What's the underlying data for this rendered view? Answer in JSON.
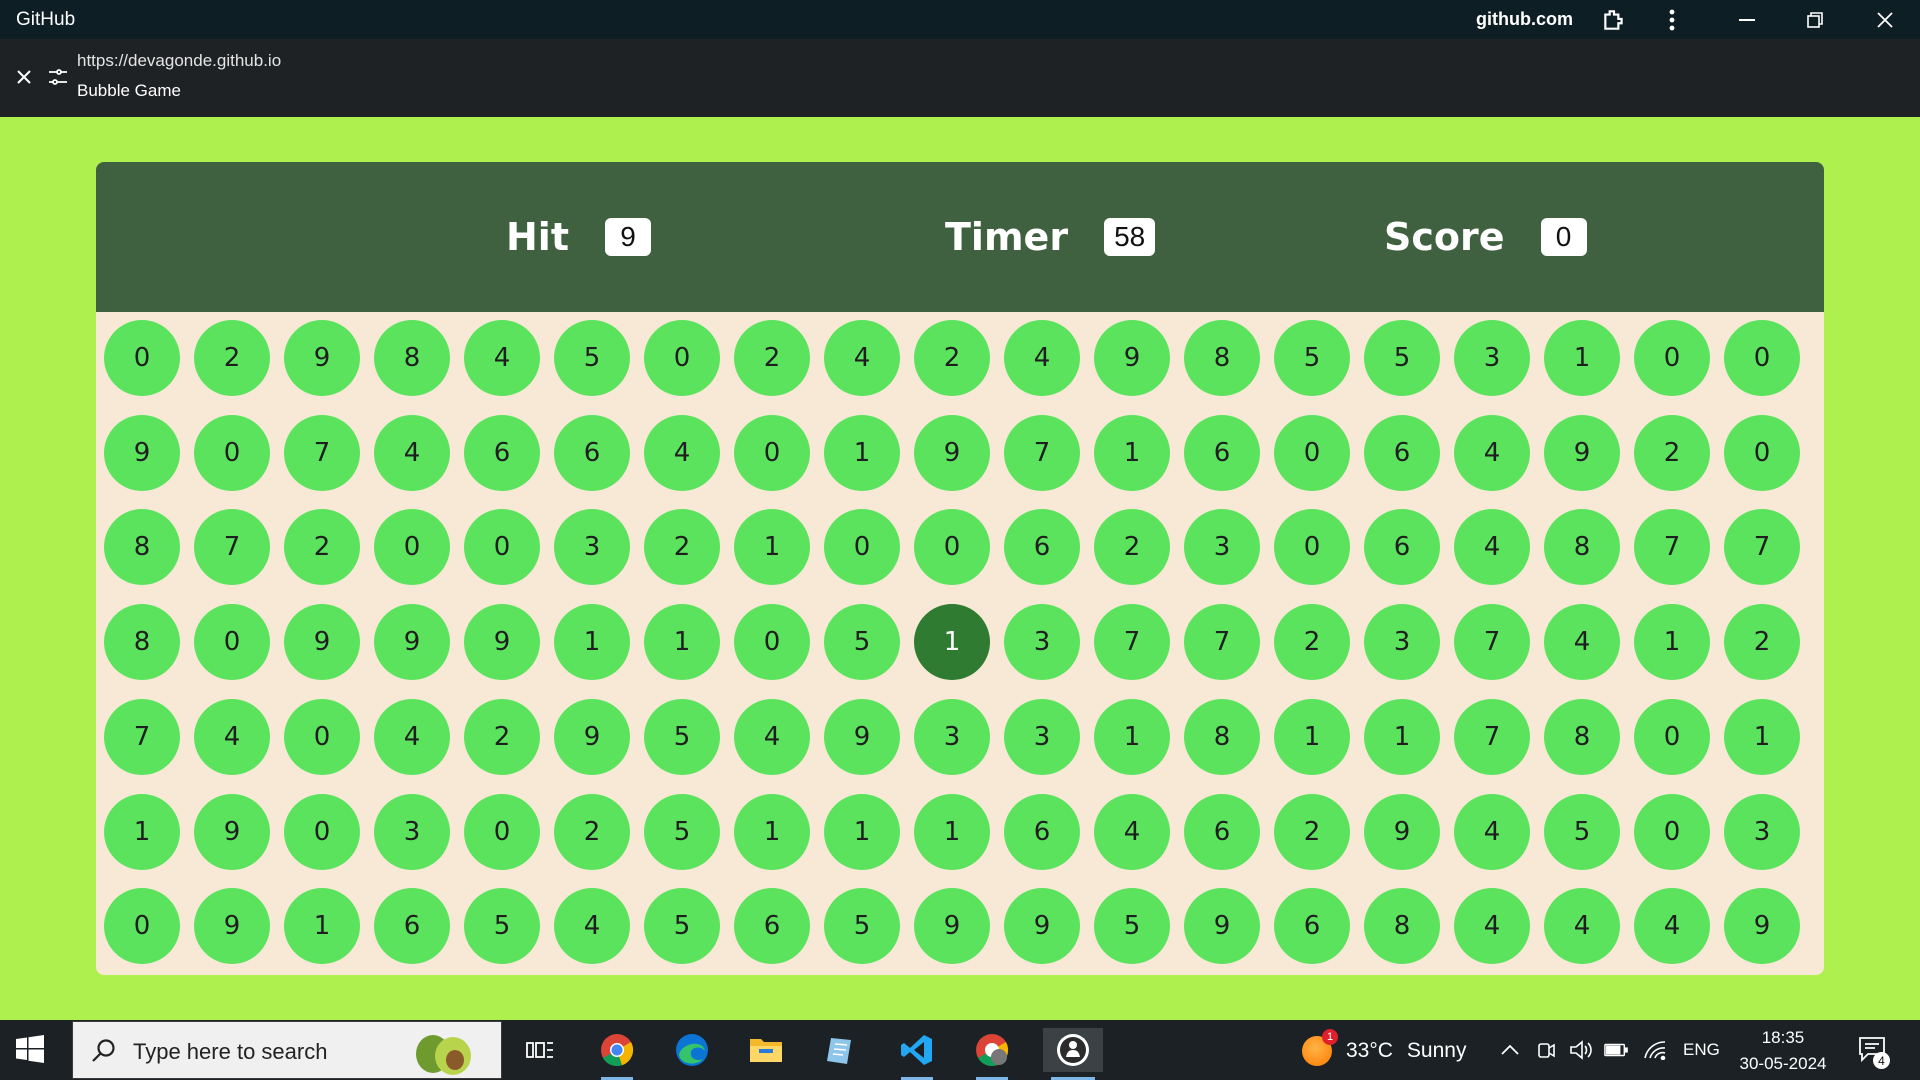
{
  "window": {
    "app_title": "GitHub",
    "host": "github.com",
    "url": "https://devagonde.github.io",
    "page_title": "Bubble Game"
  },
  "game": {
    "hit_label": "Hit",
    "hit_value": "9",
    "timer_label": "Timer",
    "timer_value": "58",
    "score_label": "Score",
    "score_value": "0",
    "highlighted": {
      "row": 3,
      "col": 9
    },
    "grid": [
      [
        0,
        2,
        9,
        8,
        4,
        5,
        0,
        2,
        4,
        2,
        4,
        9,
        8,
        5,
        5,
        3,
        1,
        0,
        0
      ],
      [
        9,
        0,
        7,
        4,
        6,
        6,
        4,
        0,
        1,
        9,
        7,
        1,
        6,
        0,
        6,
        4,
        9,
        2,
        0
      ],
      [
        8,
        7,
        2,
        0,
        0,
        3,
        2,
        1,
        0,
        0,
        6,
        2,
        3,
        0,
        6,
        4,
        8,
        7,
        7
      ],
      [
        8,
        0,
        9,
        9,
        9,
        1,
        1,
        0,
        5,
        1,
        3,
        7,
        7,
        2,
        3,
        7,
        4,
        1,
        2
      ],
      [
        7,
        4,
        0,
        4,
        2,
        9,
        5,
        4,
        9,
        3,
        3,
        1,
        8,
        1,
        1,
        7,
        8,
        0,
        1
      ],
      [
        1,
        9,
        0,
        3,
        0,
        2,
        5,
        1,
        1,
        1,
        6,
        4,
        6,
        2,
        9,
        4,
        5,
        0,
        3
      ],
      [
        0,
        9,
        1,
        6,
        5,
        4,
        5,
        6,
        5,
        9,
        9,
        5,
        9,
        6,
        8,
        4,
        4,
        4,
        9
      ]
    ],
    "colors": {
      "bubble": "#5be35e",
      "bubble_active": "#2f7b31",
      "header": "#3f6140",
      "board": "#f8e9d7",
      "page": "#aef04e"
    }
  },
  "taskbar": {
    "search_placeholder": "Type here to search",
    "weather_temp": "33°C",
    "weather_cond": "Sunny",
    "weather_badge": "1",
    "language": "ENG",
    "time": "18:35",
    "date": "30-05-2024",
    "notification_count": "4",
    "apps": [
      "task-view",
      "chrome",
      "edge",
      "file-explorer",
      "notepad",
      "vscode",
      "chrome-profile",
      "github-desktop"
    ]
  }
}
